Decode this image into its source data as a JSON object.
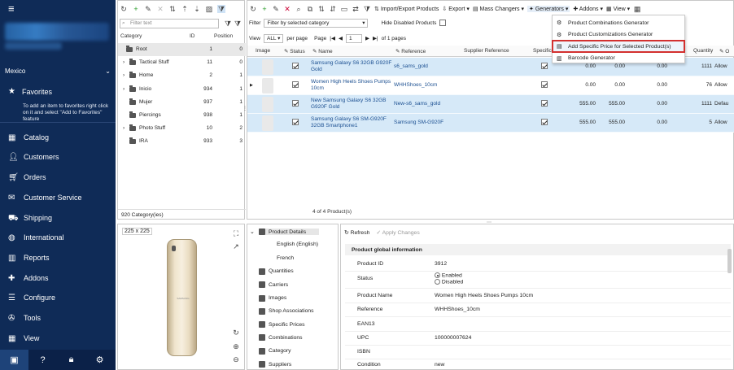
{
  "sidebar": {
    "shop_name": "Mexico",
    "favorites": {
      "label": "Favorites",
      "note": "To add an item to favorites right click on it and select \"Add to Favorites\" feature"
    },
    "items": [
      {
        "label": "Catalog",
        "icon": "catalog-icon"
      },
      {
        "label": "Customers",
        "icon": "customers-icon"
      },
      {
        "label": "Orders",
        "icon": "orders-icon"
      },
      {
        "label": "Customer Service",
        "icon": "customer-service-icon"
      },
      {
        "label": "Shipping",
        "icon": "truck-icon"
      },
      {
        "label": "International",
        "icon": "globe-icon"
      },
      {
        "label": "Reports",
        "icon": "chart-icon"
      },
      {
        "label": "Addons",
        "icon": "puzzle-icon"
      },
      {
        "label": "Configure",
        "icon": "sliders-icon"
      },
      {
        "label": "Tools",
        "icon": "wrench-icon"
      },
      {
        "label": "View",
        "icon": "view-icon"
      }
    ]
  },
  "categories": {
    "filter_placeholder": "Filter text",
    "headers": {
      "category": "Category",
      "id": "ID",
      "position": "Position"
    },
    "rows": [
      {
        "name": "Root",
        "id": "1",
        "pos": "0",
        "level": 0,
        "expander": "",
        "selected": true
      },
      {
        "name": "Tactical Stuff",
        "id": "11",
        "pos": "0",
        "level": 1,
        "expander": "›"
      },
      {
        "name": "Home",
        "id": "2",
        "pos": "1",
        "level": 1,
        "expander": "›"
      },
      {
        "name": "Inicio",
        "id": "934",
        "pos": "1",
        "level": 1,
        "expander": "›"
      },
      {
        "name": "Mujer",
        "id": "937",
        "pos": "1",
        "level": 1,
        "expander": ""
      },
      {
        "name": "Piercings",
        "id": "938",
        "pos": "1",
        "level": 1,
        "expander": ""
      },
      {
        "name": "Photo Stuff",
        "id": "10",
        "pos": "2",
        "level": 1,
        "expander": "›"
      },
      {
        "name": "IRA",
        "id": "933",
        "pos": "3",
        "level": 1,
        "expander": ""
      }
    ],
    "status": "920 Category(ies)"
  },
  "toolbar": {
    "import_export": "Import/Export Products",
    "export": "Export",
    "mass_changers": "Mass Changers",
    "generators": "Generators",
    "addons": "Addons",
    "view": "View"
  },
  "filterbar": {
    "filter_label": "Filter",
    "filter_value": "Filter by selected category",
    "hide_disabled": "Hide Disabled Products",
    "view_label": "View",
    "view_value": "ALL",
    "per_page": "per page",
    "page_label": "Page",
    "page_value": "1",
    "of_pages": "of 1 pages"
  },
  "grid": {
    "headers": {
      "image": "Image",
      "status": "Status",
      "name": "Name",
      "reference": "Reference",
      "supplier_ref": "Supplier Reference",
      "specific": "Specific",
      "quantity": "Quantity",
      "o": "O"
    },
    "rows": [
      {
        "name": "Samsung Galaxy S6 32GB G920F Gold",
        "reference": "s6_sams_gold",
        "v1": "0.00",
        "v2": "0.00",
        "v3": "0.00",
        "qty": "1111",
        "last": "Allow",
        "status": true,
        "specific": true,
        "highlight": true
      },
      {
        "name": "Women High Heels Shoes Pumps 10cm",
        "reference": "WHHShoes_10cm",
        "v1": "0.00",
        "v2": "0.00",
        "v3": "0.00",
        "qty": "76",
        "last": "Allow",
        "status": true,
        "specific": true,
        "highlight": false
      },
      {
        "name": "New Samsung Galaxy S6 32GB G920F Gold",
        "reference": "New-s6_sams_gold",
        "v1": "555.00",
        "v2": "555.00",
        "v3": "0.00",
        "qty": "1111",
        "last": "Defau",
        "status": true,
        "specific": true,
        "highlight": true
      },
      {
        "name": "Samsung Galaxy S6 SM-G920F 32GB Smartphone1",
        "reference": "Samsung SM-G920F",
        "v1": "555.00",
        "v2": "555.00",
        "v3": "0.00",
        "qty": "5",
        "last": "Allow",
        "status": true,
        "specific": true,
        "highlight": true
      }
    ],
    "footer": "4 of 4 Product(s)"
  },
  "generators_menu": {
    "items": [
      {
        "label": "Product Combinations Generator",
        "highlighted": false
      },
      {
        "label": "Product Customizations Generator",
        "highlighted": false
      },
      {
        "label": "Add Specific Price for Selected Product(s)",
        "highlighted": true
      },
      {
        "label": "Barcode Generator",
        "highlighted": false
      }
    ],
    "highlight_color": "#d3302f"
  },
  "image_panel": {
    "size_label": "225 x 225",
    "phone_logo": "SAMSUNG"
  },
  "details_tree": {
    "items": [
      {
        "label": "Product Details",
        "expanded": true
      },
      {
        "label": "English (English)",
        "child": true
      },
      {
        "label": "French",
        "child": true
      },
      {
        "label": "Quantities"
      },
      {
        "label": "Carriers"
      },
      {
        "label": "Images"
      },
      {
        "label": "Shop Associations"
      },
      {
        "label": "Specific Prices"
      },
      {
        "label": "Combinations"
      },
      {
        "label": "Category"
      },
      {
        "label": "Suppliers"
      }
    ]
  },
  "product_info": {
    "refresh": "Refresh",
    "apply": "Apply Changes",
    "section": "Product global information",
    "rows": [
      {
        "label": "Product ID",
        "value": "3912"
      },
      {
        "label": "Status",
        "value": ""
      },
      {
        "label": "Product Name",
        "value": "Women High Heels Shoes Pumps 10cm"
      },
      {
        "label": "Reference",
        "value": "WHHShoes_10cm"
      },
      {
        "label": "EAN13",
        "value": ""
      },
      {
        "label": "UPC",
        "value": "100000007624"
      },
      {
        "label": "ISBN",
        "value": ""
      },
      {
        "label": "Condition",
        "value": "new"
      }
    ],
    "status_enabled": "Enabled",
    "status_disabled": "Disabled"
  },
  "colors": {
    "sidebar_bg": "#0f2b57",
    "row_highlight": "#d6e9f8",
    "accent": "#1b4f91"
  }
}
